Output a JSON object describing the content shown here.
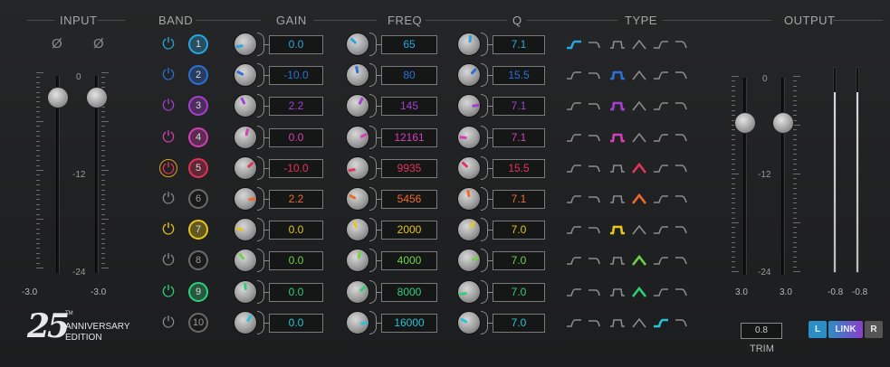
{
  "headers": {
    "input": "INPUT",
    "band": "BAND",
    "gain": "GAIN",
    "freq": "FREQ",
    "q": "Q",
    "type": "TYPE",
    "output": "OUTPUT"
  },
  "input": {
    "phase_symbol": "Ø",
    "scale_top": "0",
    "scale_mid": "-12",
    "scale_bottom": "-24",
    "left_value": "-3.0",
    "right_value": "-3.0"
  },
  "output": {
    "scale_top": "0",
    "scale_mid": "-12",
    "scale_bottom": "-24",
    "left_value": "3.0",
    "right_value": "3.0",
    "meter_left": "-0.8",
    "meter_right": "-0.8",
    "trim_value": "0.8",
    "trim_label": "TRIM",
    "btn_left": "L",
    "btn_link": "LINK",
    "btn_right": "R"
  },
  "logo": {
    "number": "25",
    "tm": "TM",
    "line1": "ANNIVERSARY",
    "line2": "EDITION"
  },
  "icons": {
    "power": "⏻",
    "types": [
      "low-shelf-icon",
      "high-cut-icon",
      "bandpass-icon",
      "peak-icon",
      "high-shelf-icon",
      "low-cut-icon"
    ]
  },
  "bands": [
    {
      "num": "1",
      "gain": "0.0",
      "freq": "65",
      "q": "7.1",
      "color": "#2aa6de",
      "active_type": 0,
      "on": true
    },
    {
      "num": "2",
      "gain": "-10.0",
      "freq": "80",
      "q": "15.5",
      "color": "#2e6fd6",
      "active_type": 2,
      "on": true
    },
    {
      "num": "3",
      "gain": "2.2",
      "freq": "145",
      "q": "7.1",
      "color": "#a63fd0",
      "active_type": 2,
      "on": true
    },
    {
      "num": "4",
      "gain": "0.0",
      "freq": "12161",
      "q": "7.1",
      "color": "#d43fb8",
      "active_type": 2,
      "on": true
    },
    {
      "num": "5",
      "gain": "-10.0",
      "freq": "9935",
      "q": "15.5",
      "color": "#e2345a",
      "active_type": 3,
      "on": true
    },
    {
      "num": "6",
      "gain": "2.2",
      "freq": "5456",
      "q": "7.1",
      "color": "#ee6a2a",
      "active_type": 3,
      "on": false
    },
    {
      "num": "7",
      "gain": "0.0",
      "freq": "2000",
      "q": "7.0",
      "color": "#e6c51e",
      "active_type": 2,
      "on": true
    },
    {
      "num": "8",
      "gain": "0.0",
      "freq": "4000",
      "q": "7.0",
      "color": "#6ed246",
      "active_type": 3,
      "on": false
    },
    {
      "num": "9",
      "gain": "0.0",
      "freq": "8000",
      "q": "7.0",
      "color": "#2fcf7a",
      "active_type": 3,
      "on": true
    },
    {
      "num": "10",
      "gain": "0.0",
      "freq": "16000",
      "q": "7.0",
      "color": "#27c3d9",
      "active_type": 4,
      "on": false
    }
  ]
}
